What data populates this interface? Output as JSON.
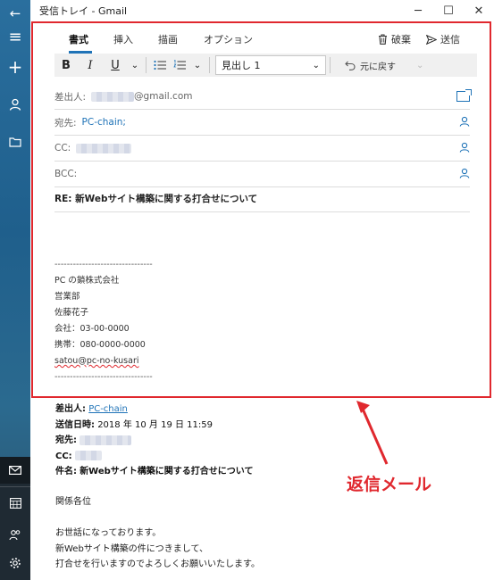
{
  "window": {
    "title": "受信トレイ - Gmail",
    "minimize": "─",
    "maximize": "☐",
    "close": "✕"
  },
  "rail": {
    "back": "←",
    "menu": "≡",
    "new_mail": "+",
    "accounts": "person-icon",
    "folders": "folder-icon"
  },
  "tabs": [
    "書式",
    "挿入",
    "描画",
    "オプション"
  ],
  "actions": {
    "discard": "破棄",
    "send": "送信"
  },
  "toolbar": {
    "bold": "B",
    "italic": "I",
    "underline": "U",
    "heading": "見出し 1",
    "undo": "元に戻す"
  },
  "fields": {
    "from_label": "差出人:",
    "from_value": "@gmail.com",
    "to_label": "宛先:",
    "to_value": "PC-chain;",
    "cc_label": "CC:",
    "bcc_label": "BCC:"
  },
  "subject": "RE: 新Webサイト構築に関する打合せについて",
  "signature": {
    "divider": "--------------------------------",
    "company": "PC の鎖株式会社",
    "department": "営業部",
    "name": "佐藤花子",
    "office_phone": "会社：03-00-0000",
    "mobile_phone": "携帯：080-0000-0000",
    "email": "satou@pc-no-kusari"
  },
  "quoted": {
    "from_label": "差出人:",
    "from_value": "PC-chain",
    "sent_label": "送信日時:",
    "sent_value": "2018 年 10 月 19 日 11:59",
    "to_label": "宛先:",
    "cc_label": "CC:",
    "subject_label": "件名:",
    "subject_value": "新Webサイト構築に関する打合せについて"
  },
  "body": {
    "line1": "関係各位",
    "line2": "お世話になっております。",
    "line3": "新Webサイト構築の件につきまして、",
    "line4": "打合せを行いますのでよろしくお願いいたします。"
  },
  "annotation": {
    "label": "返信メール",
    "color": "#e0282e"
  },
  "colors": {
    "accent": "#1f73b7",
    "highlight": "#e0282e"
  }
}
